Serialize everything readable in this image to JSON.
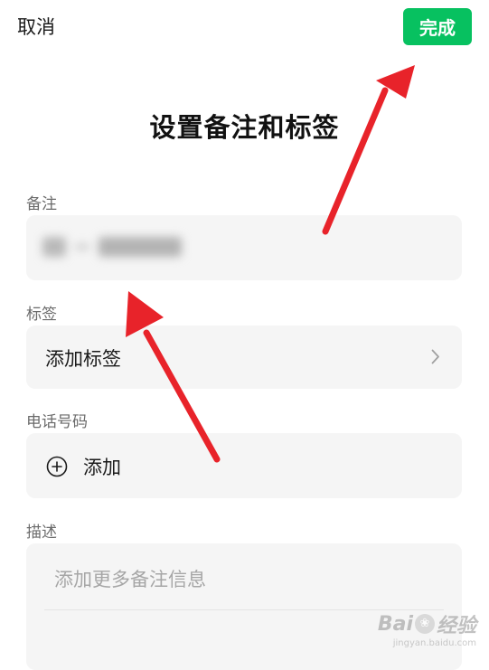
{
  "header": {
    "cancel_label": "取消",
    "done_label": "完成",
    "done_color": "#07c160"
  },
  "title": "设置备注和标签",
  "remark": {
    "label": "备注",
    "value_redacted": true
  },
  "tags": {
    "label": "标签",
    "add_label": "添加标签",
    "icon": "chevron-right-icon"
  },
  "phone": {
    "label": "电话号码",
    "add_label": "添加",
    "icon": "plus-circle-icon"
  },
  "description": {
    "label": "描述",
    "placeholder": "添加更多备注信息"
  },
  "annotation": {
    "arrow_color": "#e8232a"
  },
  "watermark": {
    "logo": "Bai",
    "logo_suffix": "经验",
    "url": "jingyan.baidu.com"
  }
}
